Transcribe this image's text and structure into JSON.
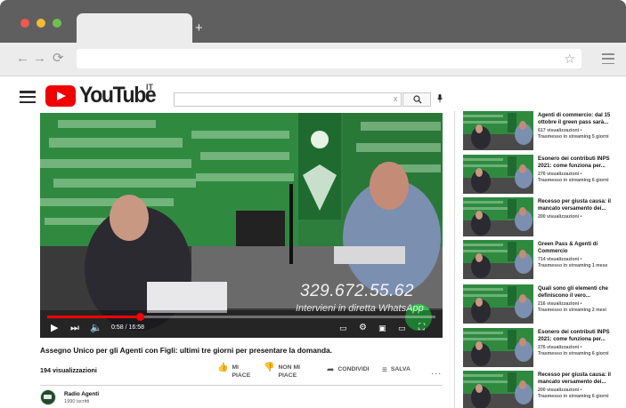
{
  "browser": {
    "new_tab_symbol": "+",
    "back_symbol": "←",
    "forward_symbol": "→",
    "reload_symbol": "⟳",
    "bookmark_symbol": "☆"
  },
  "youtube": {
    "logo_text": "YouTube",
    "country_code": "IT",
    "search_clear": "x"
  },
  "video": {
    "title": "Assegno Unico per gli Agenti con Figli: ultimi tre giorni per presentare la domanda.",
    "views": "194 visualizzazioni",
    "progress": 0.24,
    "timecode": "0:58 / 16:58",
    "overlay_phone": "329.672.55.62",
    "overlay_text": "Intervieni in diretta WhatsApp",
    "actions": {
      "like_line1": "MI",
      "like_line2": "PIACE",
      "dislike_line1": "NON MI",
      "dislike_line2": "PIACE",
      "share": "CONDIVIDI",
      "save": "SALVA",
      "more": "..."
    },
    "channel": {
      "name": "Radio Agenti",
      "subscribers": "1990 iscritti"
    }
  },
  "recommendations": [
    {
      "title": "Agenti di commercio: dal 15 ottobre il green pass sarà...",
      "views": "617 visualizzazioni •",
      "age": "Trasmesso in streaming 5 giorni"
    },
    {
      "title": "Esonero dei contributi INPS 2021: come funziona per...",
      "views": "276 visualizzazioni •",
      "age": "Trasmesso in streaming 6 giorni"
    },
    {
      "title": "Recesso per giusta causa: il mancato versamento dei...",
      "views": "200 visualizzazioni •",
      "age": ""
    },
    {
      "title": "Green Pass & Agenti di Commercio",
      "views": "714 visualizzazioni •",
      "age": "Trasmesso in streaming 1 mese"
    },
    {
      "title": "Quali sono gli elementi che definiscono il vero...",
      "views": "216 visualizzazioni •",
      "age": "Trasmesso in streaming 2 mesi"
    },
    {
      "title": "Esonero dei contributi INPS 2021: come funziona per...",
      "views": "276 visualizzazioni •",
      "age": "Trasmesso in streaming 6 giorni"
    },
    {
      "title": "Recesso per giusta causa: il mancato versamento dei...",
      "views": "200 visualizzazioni •",
      "age": "Trasmesso in streaming 6 giorni"
    }
  ]
}
